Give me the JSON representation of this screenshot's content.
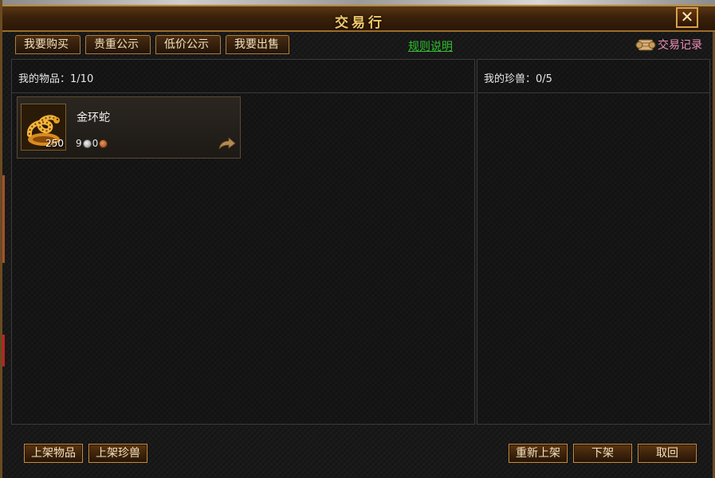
{
  "window": {
    "title": "交易行"
  },
  "tabs": [
    {
      "label": "我要购买"
    },
    {
      "label": "贵重公示"
    },
    {
      "label": "低价公示"
    },
    {
      "label": "我要出售"
    }
  ],
  "header_links": {
    "rules": "规则说明",
    "records": "交易记录"
  },
  "left_panel": {
    "label": "我的物品：",
    "count": "1/10",
    "items": [
      {
        "name": "金环蛇",
        "quantity": "250",
        "price_silver": "9",
        "price_copper": "0",
        "icon": "golden-snake-icon"
      }
    ]
  },
  "right_panel": {
    "label": "我的珍兽：",
    "count": "0/5"
  },
  "bottom_buttons": {
    "list_item": "上架物品",
    "list_pet": "上架珍兽",
    "relist": "重新上架",
    "delist": "下架",
    "retrieve": "取回"
  },
  "colors": {
    "title": "#f2c96a",
    "link_green": "#2ec02e",
    "record_pink": "#f08db6",
    "frame_gold": "#c38c3f"
  }
}
